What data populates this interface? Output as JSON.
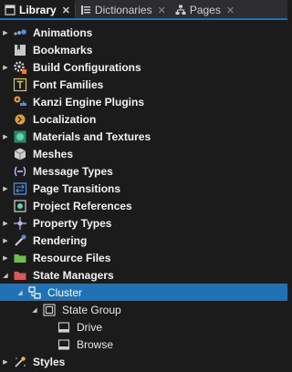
{
  "tabs": [
    {
      "label": "Library",
      "close": "✕",
      "icon": "library-icon",
      "active": true
    },
    {
      "label": "Dictionaries",
      "close": "✕",
      "icon": "dictionary-icon",
      "active": false
    },
    {
      "label": "Pages",
      "close": "✕",
      "icon": "pages-icon",
      "active": false
    }
  ],
  "tree": [
    {
      "label": "Animations",
      "expander": "▶",
      "icon": "animations-icon"
    },
    {
      "label": "Bookmarks",
      "expander": "",
      "icon": "bookmarks-icon"
    },
    {
      "label": "Build Configurations",
      "expander": "▶",
      "icon": "build-configurations-icon"
    },
    {
      "label": "Font Families",
      "expander": "",
      "icon": "font-families-icon"
    },
    {
      "label": "Kanzi Engine Plugins",
      "expander": "",
      "icon": "plugins-icon"
    },
    {
      "label": "Localization",
      "expander": "",
      "icon": "localization-icon"
    },
    {
      "label": "Materials and Textures",
      "expander": "▶",
      "icon": "materials-icon"
    },
    {
      "label": "Meshes",
      "expander": "",
      "icon": "meshes-icon"
    },
    {
      "label": "Message Types",
      "expander": "",
      "icon": "message-types-icon"
    },
    {
      "label": "Page Transitions",
      "expander": "▶",
      "icon": "page-transitions-icon"
    },
    {
      "label": "Project References",
      "expander": "",
      "icon": "project-references-icon"
    },
    {
      "label": "Property Types",
      "expander": "▶",
      "icon": "property-types-icon"
    },
    {
      "label": "Rendering",
      "expander": "▶",
      "icon": "rendering-icon"
    },
    {
      "label": "Resource Files",
      "expander": "▶",
      "icon": "resource-files-icon"
    },
    {
      "label": "State Managers",
      "expander": "◢",
      "icon": "state-managers-icon"
    },
    {
      "label": "Cluster",
      "expander": "◢",
      "icon": "state-manager-icon",
      "selected": true
    },
    {
      "label": "State Group",
      "expander": "◢",
      "icon": "state-group-icon"
    },
    {
      "label": "Drive",
      "expander": "",
      "icon": "state-icon"
    },
    {
      "label": "Browse",
      "expander": "",
      "icon": "state-icon"
    },
    {
      "label": "Styles",
      "expander": "▶",
      "icon": "styles-icon"
    }
  ],
  "colors": {
    "accent": "#1e73b8",
    "background": "#1b1b1c"
  }
}
